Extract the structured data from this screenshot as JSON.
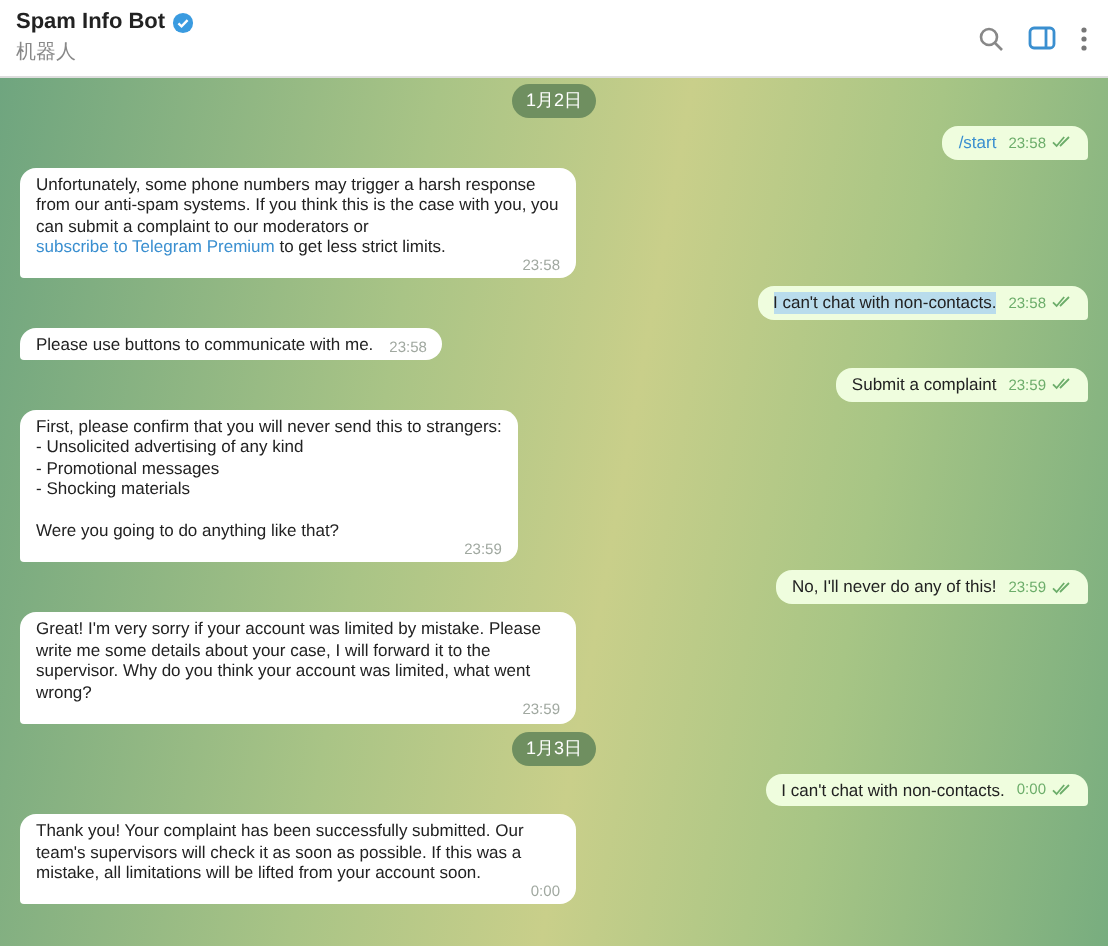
{
  "header": {
    "title": "Spam Info Bot",
    "verified": true,
    "subtitle": "机器人"
  },
  "messages": [
    {
      "kind": "date",
      "text": "1月2日"
    },
    {
      "kind": "out",
      "text": "/start",
      "command": true,
      "time": "23:58",
      "read": true,
      "highlighted": false
    },
    {
      "kind": "in",
      "text": "Unfortunately, some phone numbers may trigger a harsh response from our anti-spam systems. If you think this is the case with you, you can submit a complaint to our moderators or ",
      "link": "subscribe to Telegram Premium",
      "text_after": " to get less strict limits.",
      "time": "23:58"
    },
    {
      "kind": "out",
      "text": "I can't chat with non-contacts.",
      "command": false,
      "time": "23:58",
      "read": true,
      "highlighted": true
    },
    {
      "kind": "in",
      "text": "Please use buttons to communicate with me.",
      "time": "23:58"
    },
    {
      "kind": "out",
      "text": "Submit a complaint",
      "command": false,
      "time": "23:59",
      "read": true,
      "highlighted": false
    },
    {
      "kind": "in",
      "text": "First, please confirm that you will never send this to strangers:\n- Unsolicited advertising of any kind\n- Promotional messages\n- Shocking materials\n\nWere you going to do anything like that?",
      "time": "23:59"
    },
    {
      "kind": "out",
      "text": "No, I'll never do any of this!",
      "command": false,
      "time": "23:59",
      "read": true,
      "highlighted": false
    },
    {
      "kind": "in",
      "text": "Great! I'm very sorry if your account was limited by mistake. Please write me some details about your case, I will forward it to the supervisor. Why do you think your account was limited, what went wrong?",
      "time": "23:59"
    },
    {
      "kind": "date",
      "text": "1月3日"
    },
    {
      "kind": "out",
      "text": "I can't chat with non-contacts.",
      "command": false,
      "time": "0:00",
      "read": true,
      "highlighted": false
    },
    {
      "kind": "in",
      "text": "Thank you! Your complaint has been successfully submitted. Our team's supervisors will check it as soon as possible. If this was a mistake, all limitations will be lifted from your account soon.",
      "time": "0:00"
    }
  ]
}
